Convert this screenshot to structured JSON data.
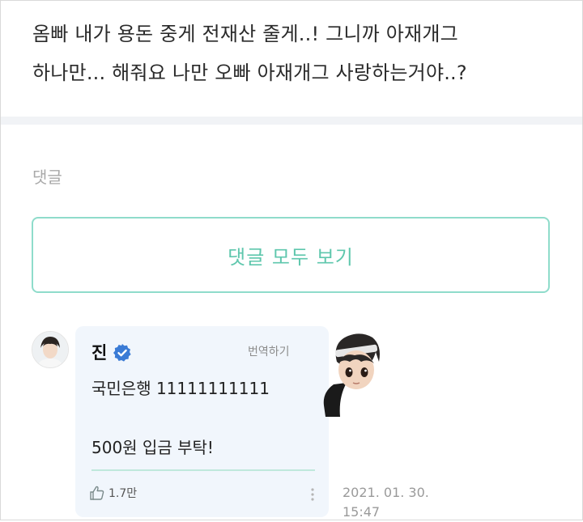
{
  "post": {
    "line1": "옴빠 내가 용돈 중게 전재산 줄게..! 그니까 아재개그",
    "line2": "하나만... 해줘요 나만 오빠 아재개그 사랑하는거야..?"
  },
  "comments_section": {
    "label": "댓글",
    "view_all_label": "댓글 모두 보기"
  },
  "comment": {
    "author": "진",
    "translate_label": "번역하기",
    "text_line1": "국민은행 11111111111",
    "text_line2": "500원 입금 부탁!",
    "like_count": "1.7만",
    "date": "2021. 01. 30.",
    "time": "15:47"
  },
  "colors": {
    "accent": "#5fc7ad",
    "accent_border": "#8fdccb",
    "verified": "#3a7bd5",
    "bubble": "#f1f6fc"
  },
  "icons": [
    "verified-badge-icon",
    "thumbs-up-icon",
    "more-options-icon"
  ]
}
